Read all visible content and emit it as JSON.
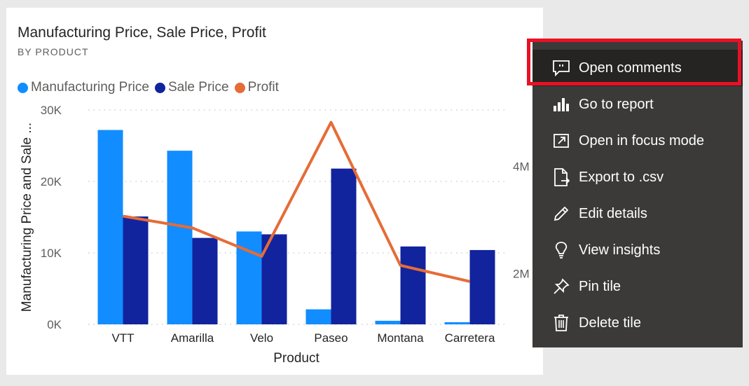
{
  "tile": {
    "title": "Manufacturing Price, Sale Price, Profit",
    "subtitle": "BY PRODUCT"
  },
  "legend": [
    {
      "label": "Manufacturing Price",
      "color": "#118dff"
    },
    {
      "label": "Sale Price",
      "color": "#12239e"
    },
    {
      "label": "Profit",
      "color": "#e66c37"
    }
  ],
  "chart_data": {
    "type": "bar",
    "title": "Manufacturing Price, Sale Price, Profit",
    "subtitle": "BY PRODUCT",
    "xlabel": "Product",
    "ylabel": "Manufacturing Price and Sale ...",
    "categories": [
      "VTT",
      "Amarilla",
      "Velo",
      "Paseo",
      "Montana",
      "Carretera"
    ],
    "ylim": [
      0,
      30000
    ],
    "y_ticks": [
      "0K",
      "10K",
      "20K",
      "30K"
    ],
    "y_tick_values": [
      0,
      10000,
      20000,
      30000
    ],
    "y2_ticks": [
      "2M",
      "4M"
    ],
    "y2_tick_values": [
      2000000,
      4000000
    ],
    "y2lim": [
      1050000,
      5050000
    ],
    "series": [
      {
        "name": "Manufacturing Price",
        "type": "bar",
        "axis": "left",
        "color": "#118dff",
        "values": [
          27200,
          24300,
          13000,
          2100,
          500,
          300
        ]
      },
      {
        "name": "Sale Price",
        "type": "bar",
        "axis": "left",
        "color": "#12239e",
        "values": [
          15100,
          12100,
          12600,
          21800,
          10900,
          10400
        ]
      },
      {
        "name": "Profit",
        "type": "line",
        "axis": "right",
        "color": "#e66c37",
        "values": [
          3070000,
          2850000,
          2320000,
          4820000,
          2150000,
          1850000
        ]
      }
    ],
    "grid": true,
    "legend_position": "top-left"
  },
  "menu": {
    "items": [
      {
        "label": "Open comments",
        "icon": "comment-icon"
      },
      {
        "label": "Go to report",
        "icon": "bar-chart-icon"
      },
      {
        "label": "Open in focus mode",
        "icon": "focus-mode-icon"
      },
      {
        "label": "Export to .csv",
        "icon": "export-icon"
      },
      {
        "label": "Edit details",
        "icon": "pencil-icon"
      },
      {
        "label": "View insights",
        "icon": "lightbulb-icon"
      },
      {
        "label": "Pin tile",
        "icon": "pin-icon"
      },
      {
        "label": "Delete tile",
        "icon": "trash-icon"
      }
    ],
    "highlight_color": "#e81123"
  }
}
